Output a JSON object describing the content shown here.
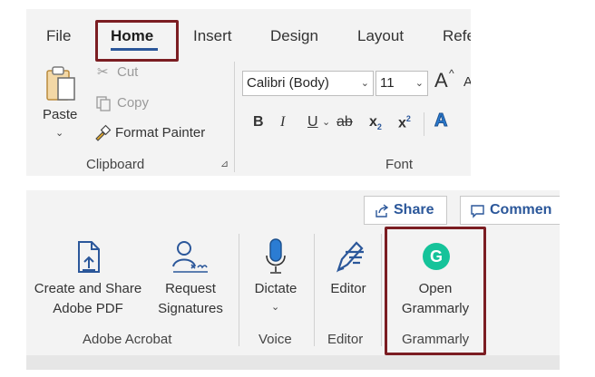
{
  "tabs": {
    "file": "File",
    "home": "Home",
    "insert": "Insert",
    "design": "Design",
    "layout": "Layout",
    "references_partial": "Refe"
  },
  "clipboard": {
    "paste": "Paste",
    "cut": "Cut",
    "copy": "Copy",
    "format_painter": "Format Painter",
    "group_label": "Clipboard"
  },
  "font": {
    "font_name": "Calibri (Body)",
    "font_size": "11",
    "grow": "A",
    "bold": "B",
    "italic": "I",
    "underline": "U",
    "strike": "ab",
    "subscript_base": "x",
    "subscript_mark": "2",
    "superscript_base": "x",
    "superscript_mark": "2",
    "text_effects": "A",
    "group_label": "Font"
  },
  "share": {
    "label": "Share"
  },
  "comments": {
    "label": "Commen"
  },
  "acrobat": {
    "create_line1": "Create and Share",
    "create_line2": "Adobe PDF",
    "request_line1": "Request",
    "request_line2": "Signatures",
    "group_label": "Adobe Acrobat"
  },
  "voice": {
    "dictate": "Dictate",
    "group_label": "Voice"
  },
  "editor": {
    "editor": "Editor",
    "group_label": "Editor"
  },
  "grammarly": {
    "open_line1": "Open",
    "open_line2": "Grammarly",
    "logo_letter": "G",
    "group_label": "Grammarly"
  },
  "colors": {
    "accent": "#2b579a",
    "highlight_box": "#7b1d22",
    "grammarly_green": "#15c39a",
    "icon_blue": "#2b579a"
  }
}
